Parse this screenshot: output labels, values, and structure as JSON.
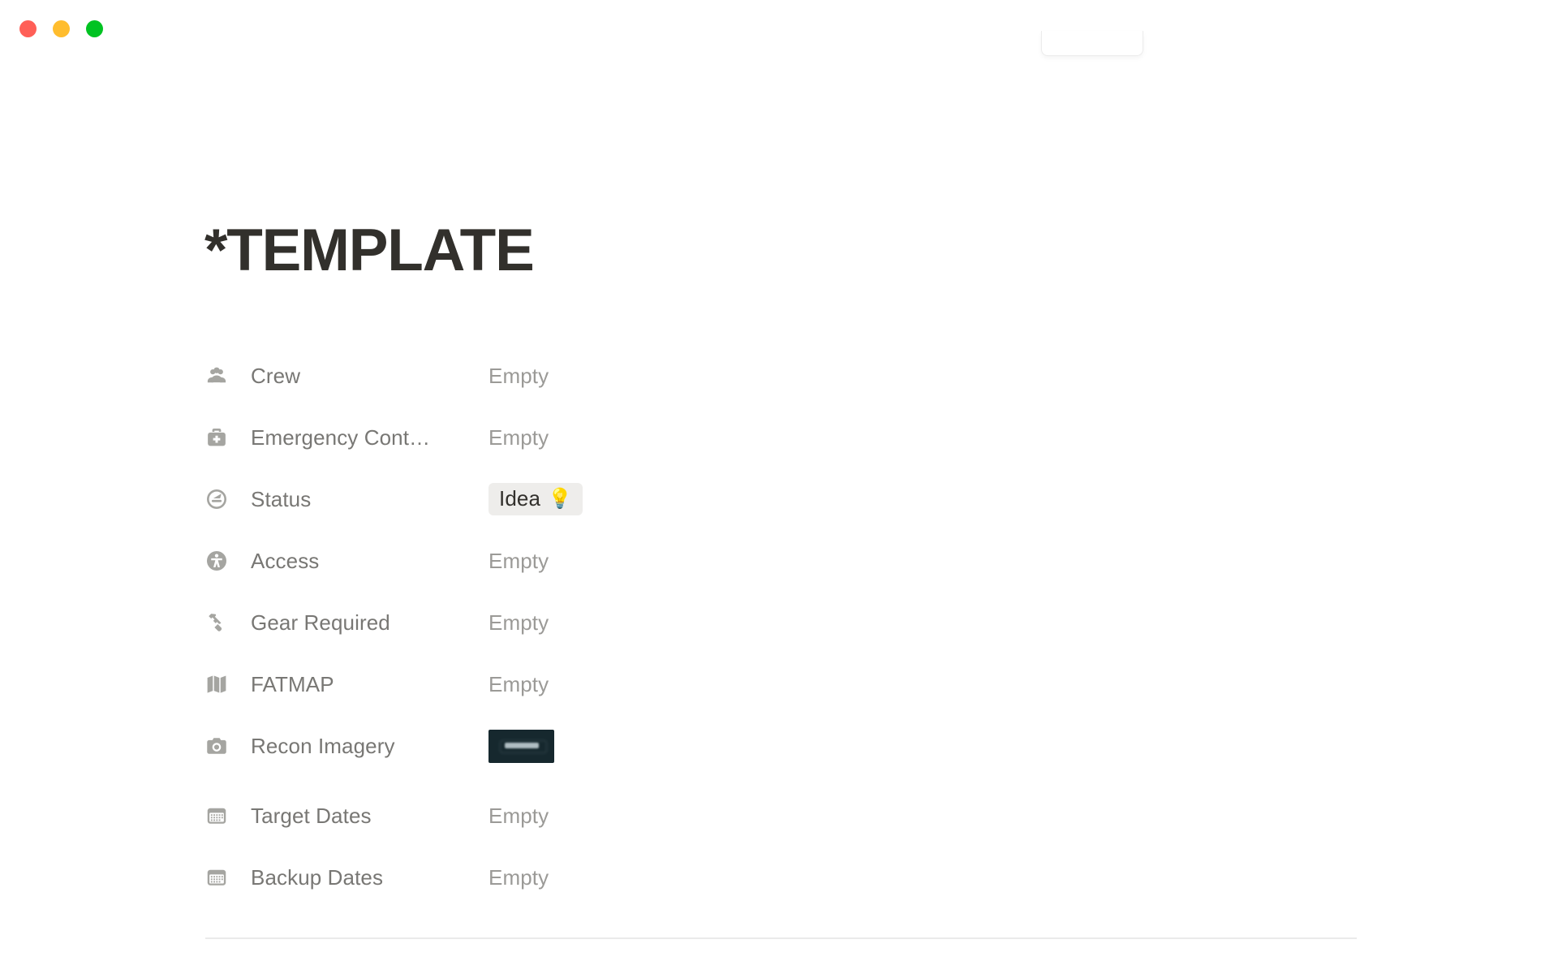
{
  "window": {
    "traffic_lights": [
      {
        "name": "close-button",
        "color": "#ff5f57"
      },
      {
        "name": "minimize-button",
        "color": "#ffbd2e"
      },
      {
        "name": "maximize-button",
        "color": "#00c322"
      }
    ]
  },
  "page": {
    "title": "*TEMPLATE",
    "empty_value": "Empty"
  },
  "properties": [
    {
      "icon": "people-group-icon",
      "label": "Crew",
      "value": "Empty",
      "value_type": "empty"
    },
    {
      "icon": "medical-kit-icon",
      "label": "Emergency Cont…",
      "value": "Empty",
      "value_type": "empty"
    },
    {
      "icon": "gauge-icon",
      "label": "Status",
      "value": "Idea",
      "value_emoji": "💡",
      "value_type": "chip",
      "chip_bg": "#eeedeb",
      "chip_text_color": "#32302c"
    },
    {
      "icon": "accessibility-icon",
      "label": "Access",
      "value": "Empty",
      "value_type": "empty"
    },
    {
      "icon": "hammer-icon",
      "label": "Gear Required",
      "value": "Empty",
      "value_type": "empty"
    },
    {
      "icon": "map-icon",
      "label": "FATMAP",
      "value": "Empty",
      "value_type": "empty"
    },
    {
      "icon": "camera-icon",
      "label": "Recon Imagery",
      "value": "",
      "value_type": "thumbnail",
      "thumbnail_color": "#16282e"
    },
    {
      "icon": "calendar-icon",
      "label": "Target Dates",
      "value": "Empty",
      "value_type": "empty"
    },
    {
      "icon": "calendar-icon",
      "label": "Backup Dates",
      "value": "Empty",
      "value_type": "empty"
    }
  ],
  "colors": {
    "title_text": "#32302c",
    "label_text": "#787774",
    "value_text": "#9b9a97",
    "icon_fill": "#a5a5a1",
    "divider": "#eaeaea",
    "background": "#ffffff"
  }
}
